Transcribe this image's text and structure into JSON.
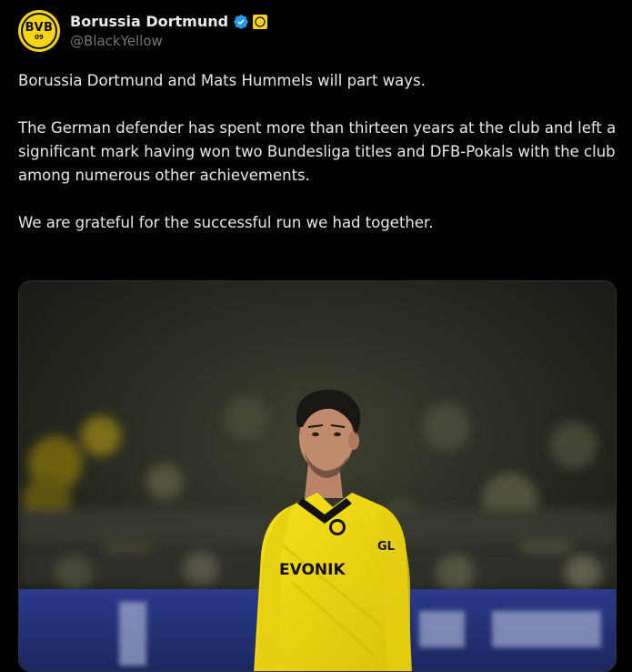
{
  "account": {
    "display_name": "Borussia Dortmund",
    "handle": "@BlackYellow",
    "avatar_text": "BVB",
    "avatar_year": "09",
    "verified_icon": "verified-badge-icon",
    "affiliate_icon": "bvb-affiliate-badge-icon"
  },
  "tweet": {
    "paragraphs": [
      "Borussia Dortmund and Mats Hummels will part ways.",
      "The German defender has spent more than thirteen years at the club and left a significant mark having won two Bundesliga titles and DFB-Pokals with the club among numerous other achievements.",
      "We are grateful for the successful run we had together."
    ]
  },
  "media": {
    "jersey_sponsor": "EVONIK",
    "sleeve_sponsor": "GL"
  },
  "colors": {
    "background": "#000000",
    "text": "#e7e9ea",
    "secondary_text": "#71767b",
    "verified_blue": "#1d9bf0",
    "bvb_yellow": "#f5d414"
  }
}
